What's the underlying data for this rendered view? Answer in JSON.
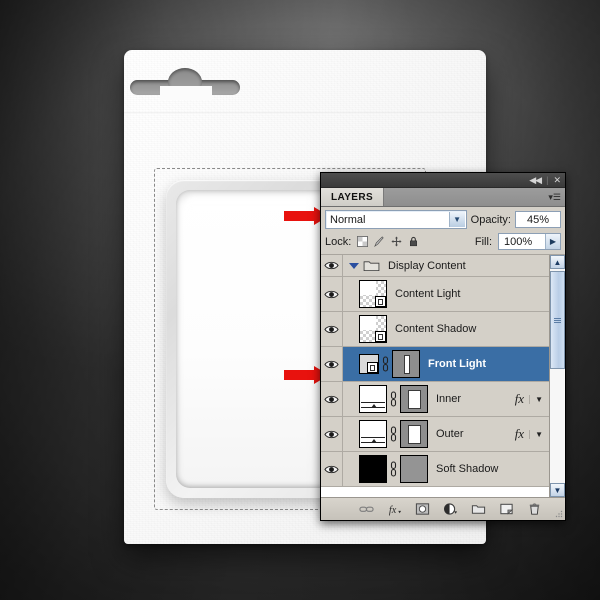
{
  "scene": {
    "title": "Photoshop layers panel over blister-pack mockup",
    "background_color": "#333333",
    "accent_color": "#3a6ea5",
    "callout_color": "#e8120e"
  },
  "canvas": {
    "card_label": "blister-pack-card",
    "tray_label": "product-tray",
    "selection_label": "marching-ants-selection"
  },
  "callouts": [
    {
      "name": "arrow-to-blend-mode",
      "direction": "right"
    },
    {
      "name": "arrow-to-opacity",
      "direction": "left"
    },
    {
      "name": "arrow-to-front-light-visibility",
      "direction": "right"
    }
  ],
  "panel": {
    "titlebar": {
      "collapse_label": "◀◀",
      "separator": "|",
      "close_label": "✕"
    },
    "tab_label": "LAYERS",
    "menu_label": "▾☰",
    "blend": {
      "mode": "Normal",
      "caret": "▼",
      "opacity_label": "Opacity:",
      "opacity_value": "45%"
    },
    "lock": {
      "label": "Lock:",
      "icons": [
        "transparency-lock-icon",
        "brush-lock-icon",
        "move-lock-icon",
        "all-lock-icon"
      ],
      "fill_label": "Fill:",
      "fill_value": "100%",
      "fill_caret": "▶"
    },
    "layers": [
      {
        "name": "Display Content",
        "type": "group",
        "visible": true,
        "selected": false,
        "expanded": true,
        "has_fx": false,
        "thumb": "folder"
      },
      {
        "name": "Content Light",
        "type": "smart-object",
        "visible": true,
        "selected": false,
        "has_fx": false,
        "thumb": "checker-shape"
      },
      {
        "name": "Content Shadow",
        "type": "smart-object",
        "visible": true,
        "selected": false,
        "has_fx": false,
        "thumb": "checker-shape"
      },
      {
        "name": "Front Light",
        "type": "smart-object-masked",
        "visible": true,
        "selected": true,
        "has_fx": false,
        "thumb": "small-smart-object",
        "mask": "bar"
      },
      {
        "name": "Inner",
        "type": "gradient-masked",
        "visible": true,
        "selected": false,
        "has_fx": true,
        "fx_label": "fx",
        "thumb": "gradient",
        "mask": "rect"
      },
      {
        "name": "Outer",
        "type": "gradient-masked",
        "visible": true,
        "selected": false,
        "has_fx": true,
        "fx_label": "fx",
        "thumb": "gradient",
        "mask": "rect"
      },
      {
        "name": "Soft Shadow",
        "type": "solid-masked",
        "visible": true,
        "selected": false,
        "has_fx": false,
        "thumb": "black",
        "mask": "gray"
      }
    ],
    "scrollbar": {
      "up_label": "▲",
      "down_label": "▼"
    },
    "footer_icons": [
      "link-layers-icon",
      "add-layer-style-icon",
      "add-layer-mask-icon",
      "new-adjustment-layer-icon",
      "new-group-icon",
      "new-layer-icon",
      "delete-layer-icon"
    ]
  }
}
